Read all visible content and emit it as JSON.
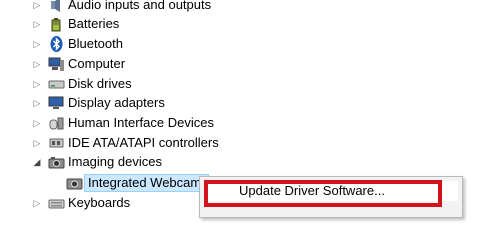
{
  "tree": {
    "items": [
      {
        "label": "Audio inputs and outputs",
        "icon": "speaker-icon",
        "expanded": false
      },
      {
        "label": "Batteries",
        "icon": "battery-icon",
        "expanded": false
      },
      {
        "label": "Bluetooth",
        "icon": "bluetooth-icon",
        "expanded": false
      },
      {
        "label": "Computer",
        "icon": "computer-icon",
        "expanded": false
      },
      {
        "label": "Disk drives",
        "icon": "disk-drive-icon",
        "expanded": false
      },
      {
        "label": "Display adapters",
        "icon": "display-adapter-icon",
        "expanded": false
      },
      {
        "label": "Human Interface Devices",
        "icon": "hid-icon",
        "expanded": false
      },
      {
        "label": "IDE ATA/ATAPI controllers",
        "icon": "ide-controller-icon",
        "expanded": false
      },
      {
        "label": "Imaging devices",
        "icon": "camera-icon",
        "expanded": true
      },
      {
        "label": "Keyboards",
        "icon": "keyboard-icon",
        "expanded": false
      }
    ],
    "child": {
      "label": "Integrated Webcam",
      "icon": "webcam-icon"
    }
  },
  "context_menu": {
    "items": [
      {
        "label": "Update Driver Software..."
      }
    ]
  },
  "colors": {
    "selection_bg": "#cce8ff",
    "highlight_box": "#d1141b"
  }
}
